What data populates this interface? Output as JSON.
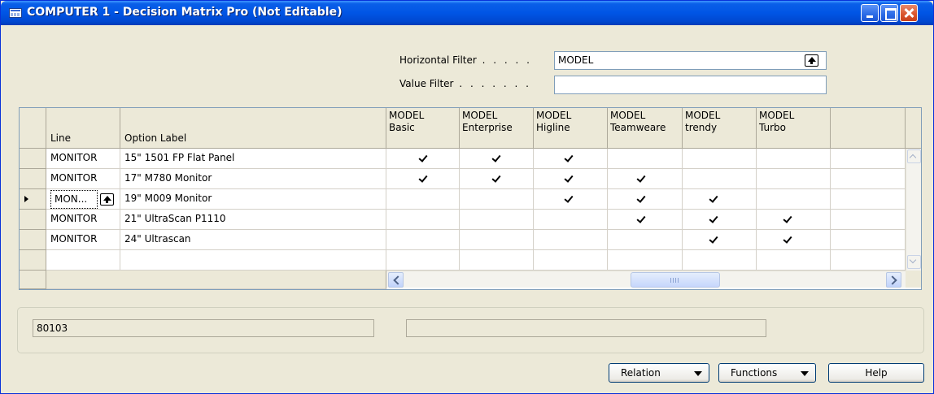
{
  "window": {
    "title": "COMPUTER 1 - Decision Matrix Pro (Not Editable)"
  },
  "filters": {
    "horizontal_label": "Horizontal Filter",
    "horizontal_value": "MODEL",
    "value_label": "Value Filter",
    "value_value": ""
  },
  "grid": {
    "col_line": "Line",
    "col_option": "Option Label",
    "matrix_cols": [
      {
        "line1": "MODEL",
        "line2": "Basic"
      },
      {
        "line1": "MODEL",
        "line2": "Enterprise"
      },
      {
        "line1": "MODEL",
        "line2": "Higline"
      },
      {
        "line1": "MODEL",
        "line2": "Teamweare"
      },
      {
        "line1": "MODEL",
        "line2": "trendy"
      },
      {
        "line1": "MODEL",
        "line2": "Turbo"
      }
    ],
    "rows": [
      {
        "line": "MONITOR",
        "option": "15\" 1501 FP Flat Panel",
        "checks": [
          true,
          true,
          true,
          false,
          false,
          false
        ]
      },
      {
        "line": "MONITOR",
        "option": "17\" M780 Monitor",
        "checks": [
          true,
          true,
          true,
          true,
          false,
          false
        ]
      },
      {
        "line": "MON...",
        "option": "19\" M009 Monitor",
        "checks": [
          false,
          false,
          true,
          true,
          true,
          false
        ],
        "selected": true
      },
      {
        "line": "MONITOR",
        "option": "21\" UltraScan P1110",
        "checks": [
          false,
          false,
          false,
          true,
          true,
          true
        ]
      },
      {
        "line": "MONITOR",
        "option": "24\" Ultrascan",
        "checks": [
          false,
          false,
          false,
          false,
          true,
          true
        ]
      }
    ]
  },
  "info": {
    "field1": "80103",
    "field2": ""
  },
  "buttons": {
    "relation": "Relation",
    "functions": "Functions",
    "help": "Help"
  }
}
